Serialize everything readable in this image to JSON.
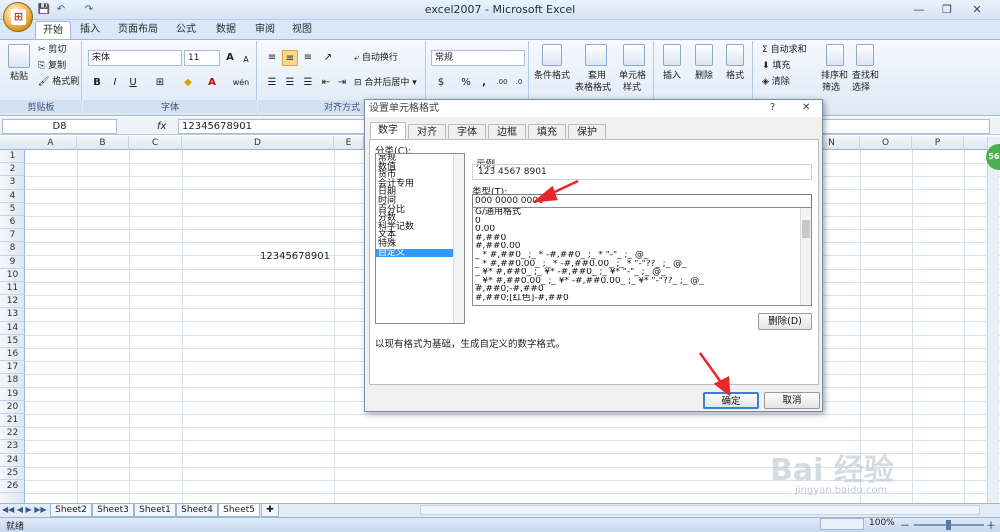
{
  "window": {
    "title": "excel2007 - Microsoft Excel",
    "restore_icon": "❐",
    "minimize_icon": "—",
    "close_icon": "✕"
  },
  "quick_access": {
    "save": "💾",
    "undo": "↶",
    "redo": "↷"
  },
  "tabs": [
    "开始",
    "插入",
    "页面布局",
    "公式",
    "数据",
    "审阅",
    "视图"
  ],
  "ribbon": {
    "clipboard": {
      "paste": "粘贴",
      "cut": "剪切",
      "copy": "复制",
      "format_painter": "格式刷",
      "label": "剪贴板"
    },
    "font": {
      "name": "宋体",
      "size": "11",
      "grow": "A",
      "shrink": "A",
      "bold": "B",
      "italic": "I",
      "underline": "U",
      "color_letter": "A",
      "phonetic": "wén",
      "label": "字体"
    },
    "alignment": {
      "wrap": "自动换行",
      "merge": "合并后居中",
      "label": "对齐方式"
    },
    "number": {
      "format": "常规",
      "currency": "$",
      "percent": "%",
      "comma": ",",
      "inc_decimal": ".00",
      "dec_decimal": ".0",
      "label": "数字"
    },
    "styles": {
      "conditional": "条件格式",
      "table_line1": "套用",
      "table_line2": "表格格式",
      "cell_line1": "单元格",
      "cell_line2": "样式"
    },
    "cells": {
      "insert": "插入",
      "delete": "删除",
      "format": "格式"
    },
    "editing": {
      "autosum": "自动求和",
      "fill": "填充",
      "clear": "清除",
      "sort_line1": "排序和",
      "sort_line2": "筛选",
      "find_line1": "查找和",
      "find_line2": "选择"
    }
  },
  "formula_bar": {
    "cell_ref": "D8",
    "fx": "fx",
    "value": "12345678901"
  },
  "grid": {
    "columns": [
      "A",
      "B",
      "C",
      "D",
      "E",
      "N",
      "O",
      "P"
    ],
    "rows": [
      "1",
      "2",
      "3",
      "4",
      "5",
      "6",
      "7",
      "8",
      "9",
      "10",
      "11",
      "12",
      "13",
      "14",
      "15",
      "16",
      "17",
      "18",
      "19",
      "20",
      "21",
      "22",
      "23",
      "24",
      "25",
      "26"
    ],
    "cell_d8": "12345678901"
  },
  "sheets": [
    "Sheet2",
    "Sheet3",
    "Sheet1",
    "Sheet4",
    "Sheet5"
  ],
  "active_sheet": "Sheet5",
  "status": {
    "ready": "就绪",
    "zoom": "100%",
    "minus": "－",
    "plus": "＋"
  },
  "dialog": {
    "title": "设置单元格格式",
    "help": "?",
    "close": "✕",
    "tabs": [
      "数字",
      "对齐",
      "字体",
      "边框",
      "填充",
      "保护"
    ],
    "category_label": "分类(C):",
    "categories": [
      "常规",
      "数值",
      "货币",
      "会计专用",
      "日期",
      "时间",
      "百分比",
      "分数",
      "科学记数",
      "文本",
      "特殊",
      "自定义"
    ],
    "selected_category": "自定义",
    "sample_label": "示例",
    "sample_value": "123 4567 8901",
    "type_label": "类型(T):",
    "type_value": "000 0000 0000",
    "type_list": [
      "G/通用格式",
      "0",
      "0.00",
      "#,##0",
      "#,##0.00",
      "_ * #,##0_ ;_ * -#,##0_ ;_ * \"-\"_ ;_ @_",
      "_ * #,##0.00_ ;_ * -#,##0.00_ ;_ * \"-\"??_ ;_ @_",
      "_ ¥* #,##0_ ;_ ¥* -#,##0_ ;_ ¥* \"-\"_ ;_ @_",
      "_ ¥* #,##0.00_ ;_ ¥* -#,##0.00_ ;_ ¥* \"-\"??_ ;_ @_",
      "#,##0;-#,##0",
      "#,##0;[红色]-#,##0"
    ],
    "delete_button": "删除(D)",
    "description": "以现有格式为基础，生成自定义的数字格式。",
    "ok": "确定",
    "cancel": "取消"
  },
  "watermark": {
    "text": "Bai 经验",
    "sub": "jingyan.baidu.com"
  },
  "badge": "56",
  "colors": {
    "arrow": "#e8262b",
    "selection": "#3399ff",
    "ribbon": "#dbe7f6"
  }
}
